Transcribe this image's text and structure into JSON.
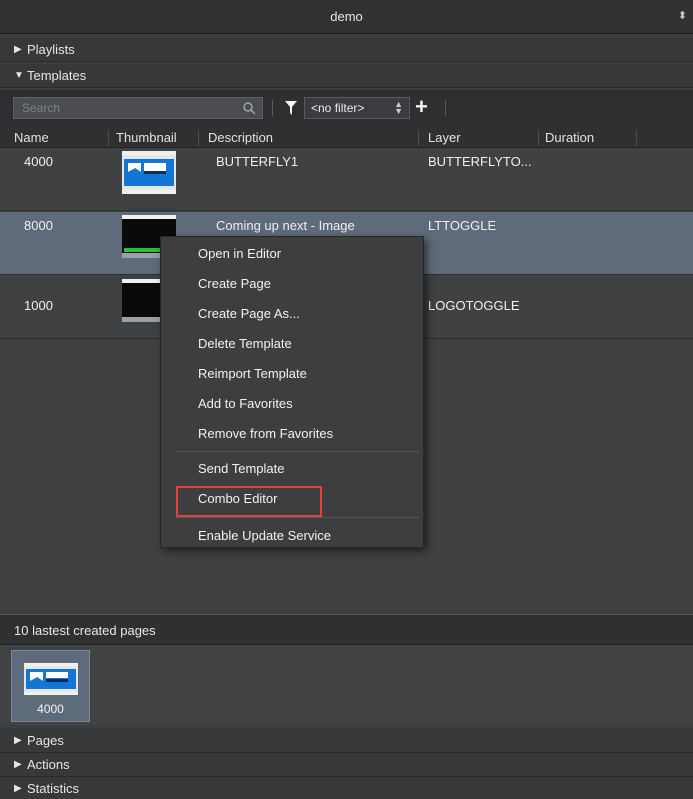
{
  "window": {
    "title": "demo",
    "menu_glyph": "⬍"
  },
  "sections": {
    "playlists": "Playlists",
    "templates": "Templates",
    "pages": "Pages",
    "actions": "Actions",
    "statistics": "Statistics"
  },
  "toolbar": {
    "search_placeholder": "Search",
    "filter_value": "<no filter>",
    "add_label": "+"
  },
  "table": {
    "columns": [
      "Name",
      "Thumbnail",
      "Description",
      "Layer",
      "Duration"
    ],
    "rows": [
      {
        "name": "4000",
        "description": "BUTTERFLY1",
        "layer": "BUTTERFLYTO..."
      },
      {
        "name": "8000",
        "description": "Coming up next - Image",
        "layer": "LTTOGGLE"
      },
      {
        "name": "1000",
        "description": "",
        "layer": "LOGOTOGGLE"
      }
    ]
  },
  "context_menu": {
    "items": [
      "Open in Editor",
      "Create Page",
      "Create Page As...",
      "Delete Template",
      "Reimport Template",
      "Add to Favorites",
      "Remove from Favorites",
      "Send Template",
      "Combo Editor",
      "Enable Update Service"
    ]
  },
  "recent_pages": {
    "title": "10 lastest created pages",
    "items": [
      {
        "label": "4000"
      }
    ]
  },
  "colors": {
    "accent_highlight": "#e3403c",
    "selected_row": "#5f6b7a"
  }
}
